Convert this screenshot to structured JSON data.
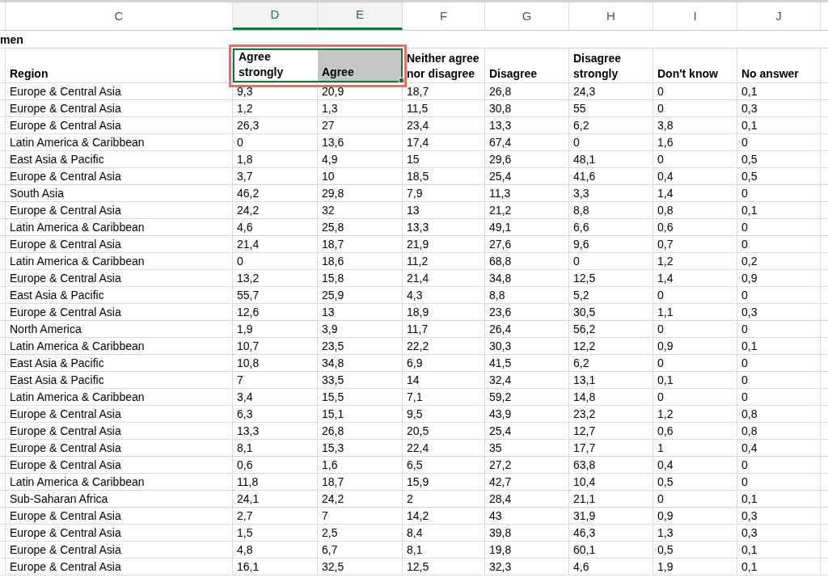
{
  "column_letters": [
    {
      "label": "C",
      "selected": false
    },
    {
      "label": "D",
      "selected": true
    },
    {
      "label": "E",
      "selected": true
    },
    {
      "label": "F",
      "selected": false
    },
    {
      "label": "G",
      "selected": false
    },
    {
      "label": "H",
      "selected": false
    },
    {
      "label": "I",
      "selected": false
    },
    {
      "label": "J",
      "selected": false
    }
  ],
  "title": "men",
  "headers": [
    {
      "label": "Region",
      "selected": false,
      "active": false,
      "highlighted": false
    },
    {
      "label": "Agree strongly",
      "selected": true,
      "active": true,
      "highlighted": true
    },
    {
      "label": "Agree",
      "selected": true,
      "active": false,
      "highlighted": true
    },
    {
      "label": "Neither agree nor disagree",
      "selected": false,
      "active": false,
      "highlighted": false
    },
    {
      "label": "Disagree",
      "selected": false,
      "active": false,
      "highlighted": false
    },
    {
      "label": "Disagree strongly",
      "selected": false,
      "active": false,
      "highlighted": false
    },
    {
      "label": "Don't know",
      "selected": false,
      "active": false,
      "highlighted": false
    },
    {
      "label": "No answer",
      "selected": false,
      "active": false,
      "highlighted": false
    }
  ],
  "rows": [
    [
      "Europe & Central Asia",
      "9,3",
      "20,9",
      "18,7",
      "26,8",
      "24,3",
      "0",
      "0,1"
    ],
    [
      "Europe & Central Asia",
      "1,2",
      "1,3",
      "11,5",
      "30,8",
      "55",
      "0",
      "0,3"
    ],
    [
      "Europe & Central Asia",
      "26,3",
      "27",
      "23,4",
      "13,3",
      "6,2",
      "3,8",
      "0,1"
    ],
    [
      "Latin America & Caribbean",
      "0",
      "13,6",
      "17,4",
      "67,4",
      "0",
      "1,6",
      "0"
    ],
    [
      "East Asia & Pacific",
      "1,8",
      "4,9",
      "15",
      "29,6",
      "48,1",
      "0",
      "0,5"
    ],
    [
      "Europe & Central Asia",
      "3,7",
      "10",
      "18,5",
      "25,4",
      "41,6",
      "0,4",
      "0,5"
    ],
    [
      "South Asia",
      "46,2",
      "29,8",
      "7,9",
      "11,3",
      "3,3",
      "1,4",
      "0"
    ],
    [
      "Europe & Central Asia",
      "24,2",
      "32",
      "13",
      "21,2",
      "8,8",
      "0,8",
      "0,1"
    ],
    [
      "Latin America & Caribbean",
      "4,6",
      "25,8",
      "13,3",
      "49,1",
      "6,6",
      "0,6",
      "0"
    ],
    [
      "Europe & Central Asia",
      "21,4",
      "18,7",
      "21,9",
      "27,6",
      "9,6",
      "0,7",
      "0"
    ],
    [
      "Latin America & Caribbean",
      "0",
      "18,6",
      "11,2",
      "68,8",
      "0",
      "1,2",
      "0,2"
    ],
    [
      "Europe & Central Asia",
      "13,2",
      "15,8",
      "21,4",
      "34,8",
      "12,5",
      "1,4",
      "0,9"
    ],
    [
      "East Asia & Pacific",
      "55,7",
      "25,9",
      "4,3",
      "8,8",
      "5,2",
      "0",
      "0"
    ],
    [
      "Europe & Central Asia",
      "12,6",
      "13",
      "18,9",
      "23,6",
      "30,5",
      "1,1",
      "0,3"
    ],
    [
      "North America",
      "1,9",
      "3,9",
      "11,7",
      "26,4",
      "56,2",
      "0",
      "0"
    ],
    [
      "Latin America & Caribbean",
      "10,7",
      "23,5",
      "22,2",
      "30,3",
      "12,2",
      "0,9",
      "0,1"
    ],
    [
      "East Asia & Pacific",
      "10,8",
      "34,8",
      "6,9",
      "41,5",
      "6,2",
      "0",
      "0"
    ],
    [
      "East Asia & Pacific",
      "7",
      "33,5",
      "14",
      "32,4",
      "13,1",
      "0,1",
      "0"
    ],
    [
      "Latin America & Caribbean",
      "3,4",
      "15,5",
      "7,1",
      "59,2",
      "14,8",
      "0",
      "0"
    ],
    [
      "Europe & Central Asia",
      "6,3",
      "15,1",
      "9,5",
      "43,9",
      "23,2",
      "1,2",
      "0,8"
    ],
    [
      "Europe & Central Asia",
      "13,3",
      "26,8",
      "20,5",
      "25,4",
      "12,7",
      "0,6",
      "0,8"
    ],
    [
      "Europe & Central Asia",
      "8,1",
      "15,3",
      "22,4",
      "35",
      "17,7",
      "1",
      "0,4"
    ],
    [
      "Europe & Central Asia",
      "0,6",
      "1,6",
      "6,5",
      "27,2",
      "63,8",
      "0,4",
      "0"
    ],
    [
      "Latin America & Caribbean",
      "11,8",
      "18,7",
      "15,9",
      "42,7",
      "10,4",
      "0,5",
      "0"
    ],
    [
      "Sub-Saharan Africa",
      "24,1",
      "24,2",
      "2",
      "28,4",
      "21,1",
      "0",
      "0,1"
    ],
    [
      "Europe & Central Asia",
      "2,7",
      "7",
      "14,2",
      "43",
      "31,9",
      "0,9",
      "0,3"
    ],
    [
      "Europe & Central Asia",
      "1,5",
      "2,5",
      "8,4",
      "39,8",
      "46,3",
      "1,3",
      "0,3"
    ],
    [
      "Europe & Central Asia",
      "4,8",
      "6,7",
      "8,1",
      "19,8",
      "60,1",
      "0,5",
      "0,1"
    ],
    [
      "Europe & Central Asia",
      "16,1",
      "32,5",
      "12,5",
      "32,3",
      "4,6",
      "1,9",
      "0,1"
    ]
  ]
}
